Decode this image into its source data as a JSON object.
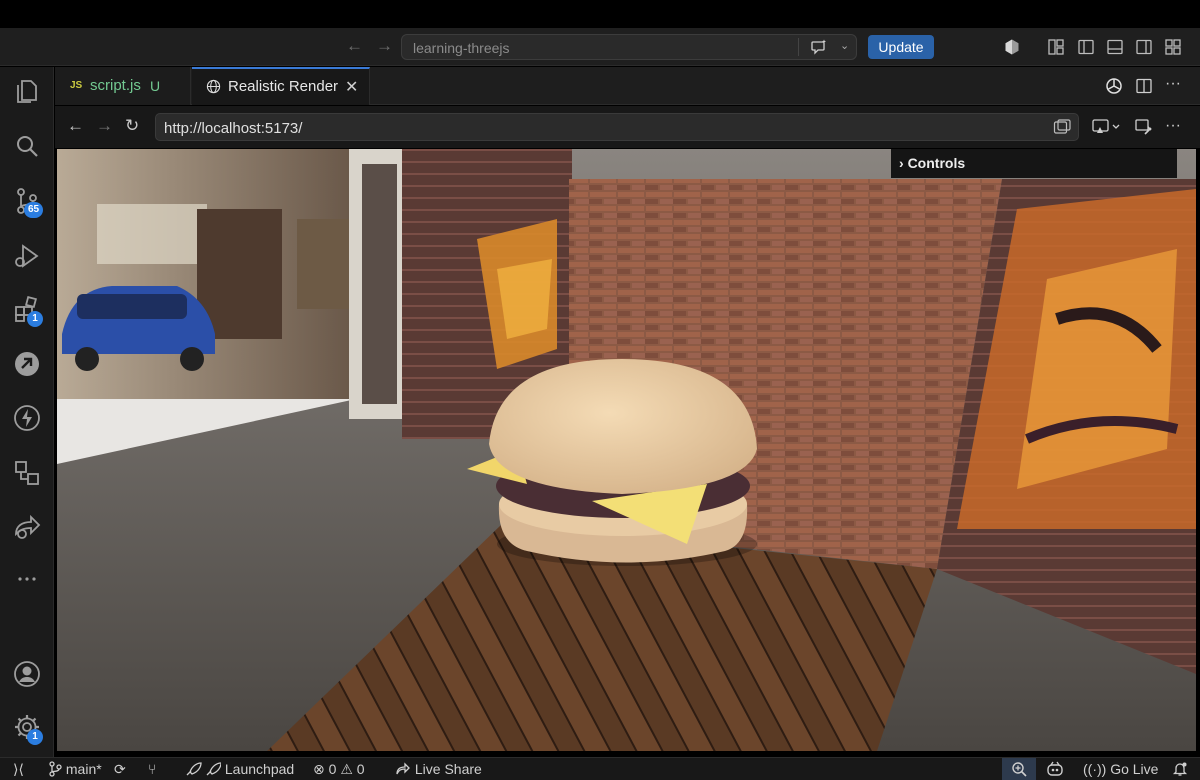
{
  "window": {
    "command_center_text": "learning-threejs",
    "update_label": "Update"
  },
  "activity_bar": {
    "source_control_badge": "65",
    "extensions_badge": "1",
    "settings_badge": "1"
  },
  "tabs": [
    {
      "icon": "JS",
      "label": "script.js",
      "status": "U"
    },
    {
      "label": "Realistic Render",
      "close": "✕"
    }
  ],
  "browser": {
    "url": "http://localhost:5173/",
    "controls_panel_label": "Controls"
  },
  "status_bar": {
    "branch": "main*",
    "launchpad": "Launchpad",
    "errors": "0",
    "warnings": "0",
    "live_share": "Live Share",
    "go_live": "Go Live"
  },
  "colors": {
    "accent": "#2b7de0",
    "update_button": "#2a62a8",
    "modified_file": "#73c991",
    "js_icon": "#cbcb41"
  }
}
